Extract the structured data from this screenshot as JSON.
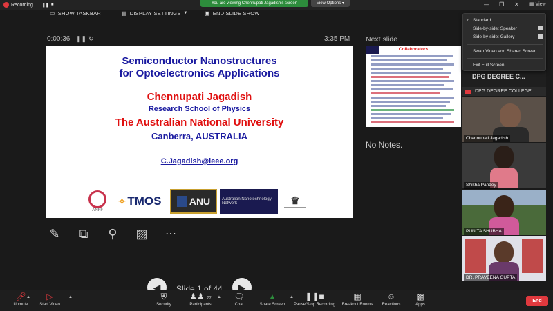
{
  "window": {
    "recording_label": "Recording...",
    "viewing_banner": "You are viewing Chennupati Jagadish's screen",
    "view_options_label": "View Options",
    "view_button": "View"
  },
  "presenter_toolbar": {
    "show_taskbar": "SHOW TASKBAR",
    "display_settings": "DISPLAY SETTINGS",
    "end_slide_show": "END SLIDE SHOW",
    "timer": "0:00:36",
    "clock": "3:35 PM"
  },
  "slide": {
    "title_line1": "Semiconductor Nanostructures",
    "title_line2": "for Optoelectronics Applications",
    "author": "Chennupati Jagadish",
    "school": "Research School of Physics",
    "university": "The Australian National University",
    "location": "Canberra, AUSTRALIA",
    "email": "C.Jagadish@ieee.org",
    "logos": {
      "anff": "ANFF",
      "tmos": "TMOS",
      "anu": "ANU",
      "ann": "Australian Nanotechnology Network"
    }
  },
  "slide_nav": {
    "label": "Slide 1 of 44"
  },
  "next_slide": {
    "label": "Next slide",
    "thumb_title": "Collaborators"
  },
  "notes": {
    "text": "No Notes."
  },
  "view_menu": {
    "items": [
      {
        "label": "Standard",
        "checked": true
      },
      {
        "label": "Side-by-side: Speaker"
      },
      {
        "label": "Side-by-side: Gallery"
      },
      {
        "label": "Swap Video and Shared Screen"
      },
      {
        "label": "Exit Full Screen"
      }
    ]
  },
  "gallery": {
    "band_label": "DPG DEGREE COLLEGE",
    "band_header": "DPG DEGREE C...",
    "participants": [
      {
        "name": "Chennupati Jagadish"
      },
      {
        "name": "Shikha Pandey"
      },
      {
        "name": "PUNITA SHUBHA"
      },
      {
        "name": "DR. PRAVEENA GUPTA"
      }
    ]
  },
  "bottom_toolbar": {
    "unmute": "Unmute",
    "start_video": "Start Video",
    "security": "Security",
    "participants": "Participants",
    "participant_count": "77",
    "chat": "Chat",
    "share_screen": "Share Screen",
    "record": "Pause/Stop Recording",
    "breakout": "Breakout Rooms",
    "reactions": "Reactions",
    "apps": "Apps",
    "end": "End"
  },
  "colors": {
    "accent_green": "#2d8c3c",
    "end_red": "#e0393e",
    "slide_blue": "#1a1aa0",
    "slide_red": "#e01010"
  }
}
